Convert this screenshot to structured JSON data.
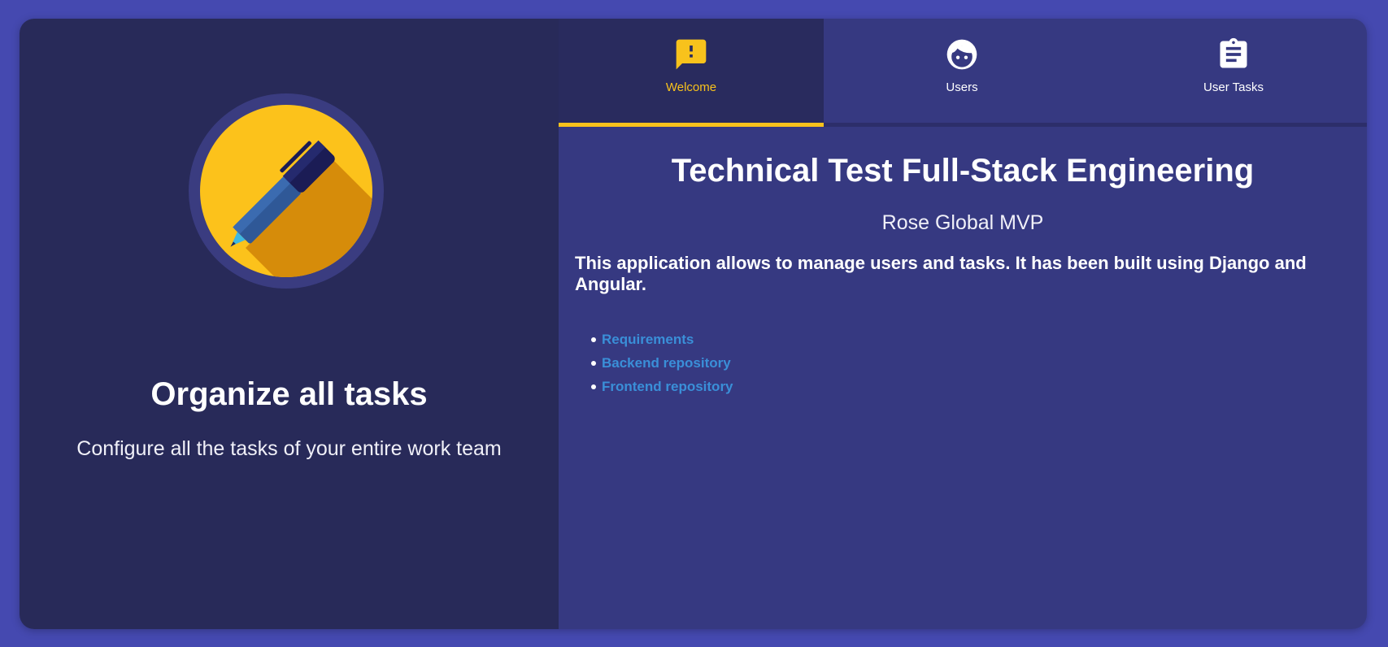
{
  "left_panel": {
    "title": "Organize all tasks",
    "subtitle": "Configure all the tasks of your entire work team"
  },
  "tabs": [
    {
      "label": "Welcome",
      "icon": "feedback-icon",
      "active": true
    },
    {
      "label": "Users",
      "icon": "face-icon",
      "active": false
    },
    {
      "label": "User Tasks",
      "icon": "assignment-icon",
      "active": false
    }
  ],
  "content": {
    "title": "Technical Test Full-Stack Engineering",
    "subtitle": "Rose Global MVP",
    "description": "This application allows to manage users and tasks. It has been built using Django and Angular.",
    "links": [
      {
        "label": "Requirements"
      },
      {
        "label": "Backend repository"
      },
      {
        "label": "Frontend repository"
      }
    ]
  },
  "colors": {
    "page_background": "#4549b0",
    "left_panel": "#282a59",
    "right_panel": "#363981",
    "accent": "#f8c21c",
    "link": "#3a8fd8"
  }
}
